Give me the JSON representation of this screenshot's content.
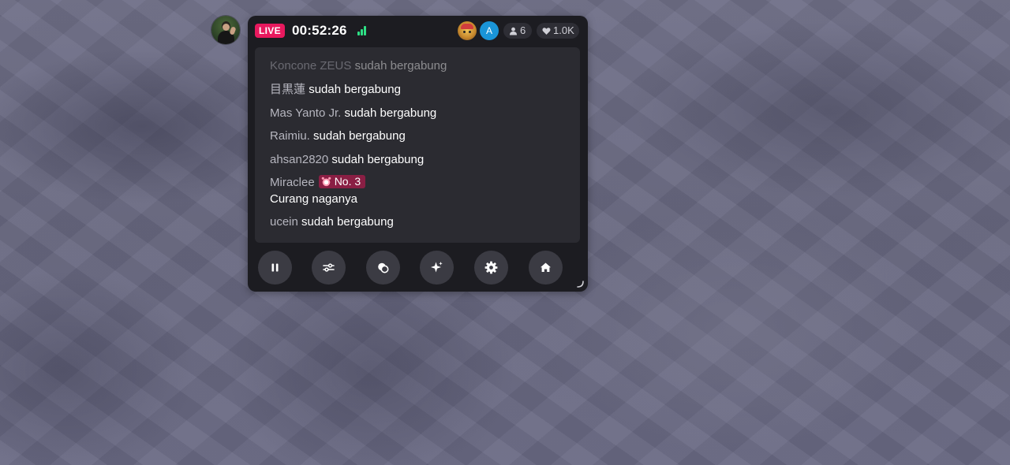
{
  "stream": {
    "live_label": "LIVE",
    "elapsed": "00:52:26",
    "viewer_count": "6",
    "like_count": "1.0K",
    "viewer_avatars": [
      {
        "kind": "cartoon-avatar"
      },
      {
        "kind": "letter-avatar",
        "letter": "A",
        "color": "#1a95d8"
      }
    ]
  },
  "chat": {
    "messages": [
      {
        "user": "Koncone ZEUS",
        "action": "sudah bergabung",
        "faded": true
      },
      {
        "user": "目黒蓮",
        "action": "sudah bergabung"
      },
      {
        "user": "Mas Yanto Jr.",
        "action": "sudah bergabung"
      },
      {
        "user": "Raimiu.",
        "action": "sudah bergabung"
      },
      {
        "user": "ahsan2820",
        "action": "sudah bergabung"
      },
      {
        "user": "Miraclee",
        "badge": "No. 3",
        "comment": "Curang naganya"
      },
      {
        "user": "ucein",
        "action": "sudah bergabung"
      }
    ]
  },
  "controls": [
    {
      "icon": "pause-icon"
    },
    {
      "icon": "sliders-icon"
    },
    {
      "icon": "effects-icon"
    },
    {
      "icon": "sparkle-icon"
    },
    {
      "icon": "settings-icon"
    },
    {
      "icon": "home-icon"
    }
  ],
  "colors": {
    "live": "#e8195e",
    "signal": "#2ee085",
    "rank_badge": "#8a1f44",
    "panel": "#1c1c21",
    "chat_bg": "#2b2b31"
  }
}
